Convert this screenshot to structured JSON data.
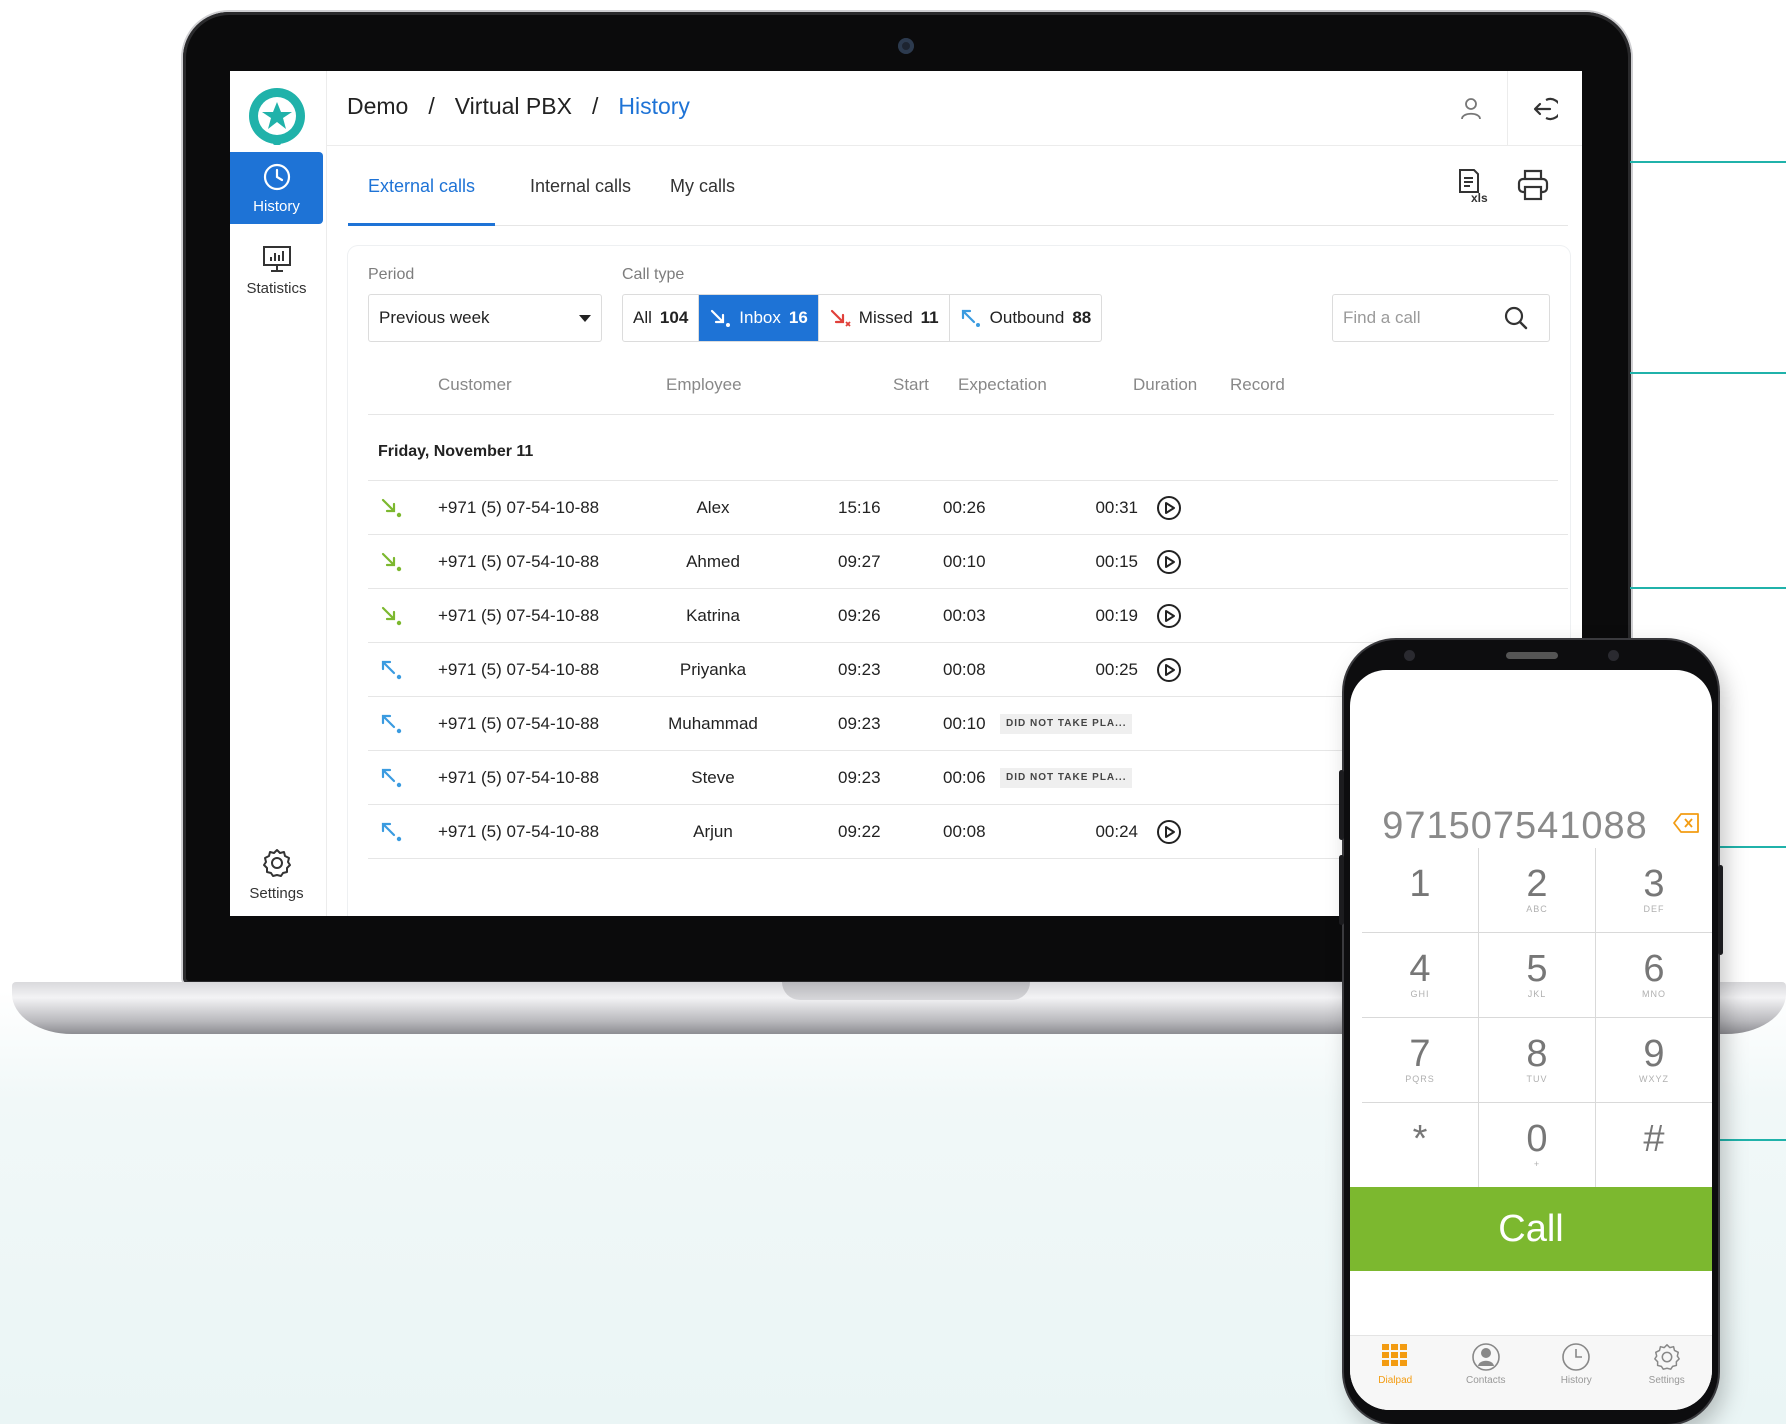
{
  "breadcrumb": [
    "Demo",
    "Virtual PBX",
    "History"
  ],
  "sidebar": {
    "items": [
      {
        "label": "History",
        "icon": "clock-icon",
        "active": true
      },
      {
        "label": "Statistics",
        "icon": "chart-icon",
        "active": false
      },
      {
        "label": "Settings",
        "icon": "gear-icon",
        "active": false
      }
    ]
  },
  "tabs": [
    {
      "label": "External calls",
      "active": true
    },
    {
      "label": "Internal calls",
      "active": false
    },
    {
      "label": "My calls",
      "active": false
    }
  ],
  "filters": {
    "period_label": "Period",
    "period_value": "Previous week",
    "call_type_label": "Call type",
    "call_types": [
      {
        "label": "All",
        "count": "104",
        "active": false
      },
      {
        "label": "Inbox",
        "count": "16",
        "active": true
      },
      {
        "label": "Missed",
        "count": "11",
        "active": false
      },
      {
        "label": "Outbound",
        "count": "88",
        "active": false
      }
    ],
    "search_placeholder": "Find a call"
  },
  "table": {
    "columns": [
      "Customer",
      "Employee",
      "Start",
      "Expectation",
      "Duration",
      "Record"
    ],
    "day_header": "Friday, November 11",
    "rows": [
      {
        "direction": "inbound",
        "customer": "+971 (5) 07-54-10-88",
        "employee": "Alex",
        "start": "15:16",
        "expectation": "00:26",
        "duration": "00:31",
        "status": "",
        "record": true
      },
      {
        "direction": "inbound",
        "customer": "+971 (5) 07-54-10-88",
        "employee": "Ahmed",
        "start": "09:27",
        "expectation": "00:10",
        "duration": "00:15",
        "status": "",
        "record": true
      },
      {
        "direction": "inbound",
        "customer": "+971 (5) 07-54-10-88",
        "employee": "Katrina",
        "start": "09:26",
        "expectation": "00:03",
        "duration": "00:19",
        "status": "",
        "record": true
      },
      {
        "direction": "outbound",
        "customer": "+971 (5) 07-54-10-88",
        "employee": "Priyanka",
        "start": "09:23",
        "expectation": "00:08",
        "duration": "00:25",
        "status": "",
        "record": true
      },
      {
        "direction": "outbound",
        "customer": "+971 (5) 07-54-10-88",
        "employee": "Muhammad",
        "start": "09:23",
        "expectation": "00:10",
        "duration": "",
        "status": "DID NOT TAKE PLA...",
        "record": false
      },
      {
        "direction": "outbound",
        "customer": "+971 (5) 07-54-10-88",
        "employee": "Steve",
        "start": "09:23",
        "expectation": "00:06",
        "duration": "",
        "status": "DID NOT TAKE PLA...",
        "record": false
      },
      {
        "direction": "outbound",
        "customer": "+971 (5) 07-54-10-88",
        "employee": "Arjun",
        "start": "09:22",
        "expectation": "00:08",
        "duration": "00:24",
        "status": "",
        "record": true
      }
    ]
  },
  "phone": {
    "dialed_number": "971507541088",
    "keys": [
      {
        "digit": "1",
        "letters": ""
      },
      {
        "digit": "2",
        "letters": "ABC"
      },
      {
        "digit": "3",
        "letters": "DEF"
      },
      {
        "digit": "4",
        "letters": "GHI"
      },
      {
        "digit": "5",
        "letters": "JKL"
      },
      {
        "digit": "6",
        "letters": "MNO"
      },
      {
        "digit": "7",
        "letters": "PQRS"
      },
      {
        "digit": "8",
        "letters": "TUV"
      },
      {
        "digit": "9",
        "letters": "WXYZ"
      },
      {
        "digit": "*",
        "letters": ""
      },
      {
        "digit": "0",
        "letters": "+"
      },
      {
        "digit": "#",
        "letters": ""
      }
    ],
    "call_label": "Call",
    "nav": [
      {
        "label": "Dialpad",
        "icon": "dialpad-icon",
        "active": true
      },
      {
        "label": "Contacts",
        "icon": "contact-icon",
        "active": false
      },
      {
        "label": "History",
        "icon": "clock-icon",
        "active": false
      },
      {
        "label": "Settings",
        "icon": "gear-icon",
        "active": false
      }
    ]
  },
  "colors": {
    "accent": "#1e73d6",
    "inbound_arrow": "#7cb82f",
    "missed_arrow": "#e0403a",
    "outbound_arrow": "#3a9be0",
    "call_button": "#7cb82f",
    "dialpad_active": "#f39c12",
    "logo": "#20b2aa"
  }
}
